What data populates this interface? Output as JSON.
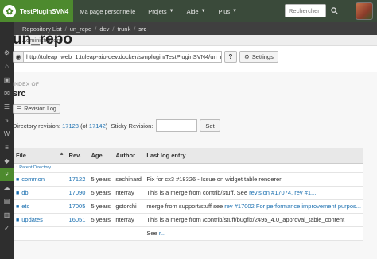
{
  "topbar": {
    "brand": "TestPluginSVN4",
    "nav": [
      {
        "label": "Ma page personnelle",
        "caret": false
      },
      {
        "label": "Projets",
        "caret": true
      },
      {
        "label": "Aide",
        "caret": true
      },
      {
        "label": "Plus",
        "caret": true
      }
    ],
    "search_placeholder": "Rechercher"
  },
  "breadcrumb": {
    "items": [
      "Repository List",
      "un_repo",
      "dev",
      "trunk",
      "src"
    ]
  },
  "admin_label": "Administration",
  "repo": {
    "title": "un_repo",
    "url": "http://tuleap_web_1.tuleap-aio-dev.docker/svnplugin/TestPluginSVN4/un_repo",
    "help_label": "?",
    "settings_label": "Settings"
  },
  "directory": {
    "index_label": "INDEX OF",
    "name": "src",
    "revision_log_label": "Revision Log",
    "revision_prefix": "Directory revision:",
    "revision": "17128",
    "of_open": "(of",
    "head_revision": "17142",
    "of_close": ")",
    "sticky_label": "Sticky Revision:",
    "set_label": "Set"
  },
  "table": {
    "headers": {
      "file": "File",
      "sort": "▲",
      "rev": "Rev.",
      "age": "Age",
      "author": "Author",
      "log": "Last log entry"
    },
    "parent_label": "Parent Directory",
    "rows": [
      {
        "name": "common",
        "rev": "17122",
        "age": "5 years",
        "author": "sechinard",
        "log": "Fix for cx3 #18326 - Issue on widget table renderer",
        "log_link": ""
      },
      {
        "name": "db",
        "rev": "17090",
        "age": "5 years",
        "author": "nterray",
        "log": "This is a merge from contrib/stuff. See ",
        "log_link": "revision #17074, rev #1..."
      },
      {
        "name": "etc",
        "rev": "17005",
        "age": "5 years",
        "author": "gstorchi",
        "log": "merge from support/stuff see ",
        "log_link": "rev #17002 For performance improvement purpos..."
      },
      {
        "name": "updates",
        "rev": "16051",
        "age": "5 years",
        "author": "nterray",
        "log": "This is a merge from /contrib/stuff/bugfix/2495_4.0_approval_table_content",
        "log_link": ""
      },
      {
        "name": "",
        "rev": "",
        "age": "",
        "author": "",
        "log": "See ",
        "log_link": "r..."
      }
    ]
  },
  "colors": {
    "brand_green": "#4d8a2e",
    "topbar": "#3a4a3a",
    "sidebar": "#2e2e2e",
    "link": "#1a6fb0"
  }
}
